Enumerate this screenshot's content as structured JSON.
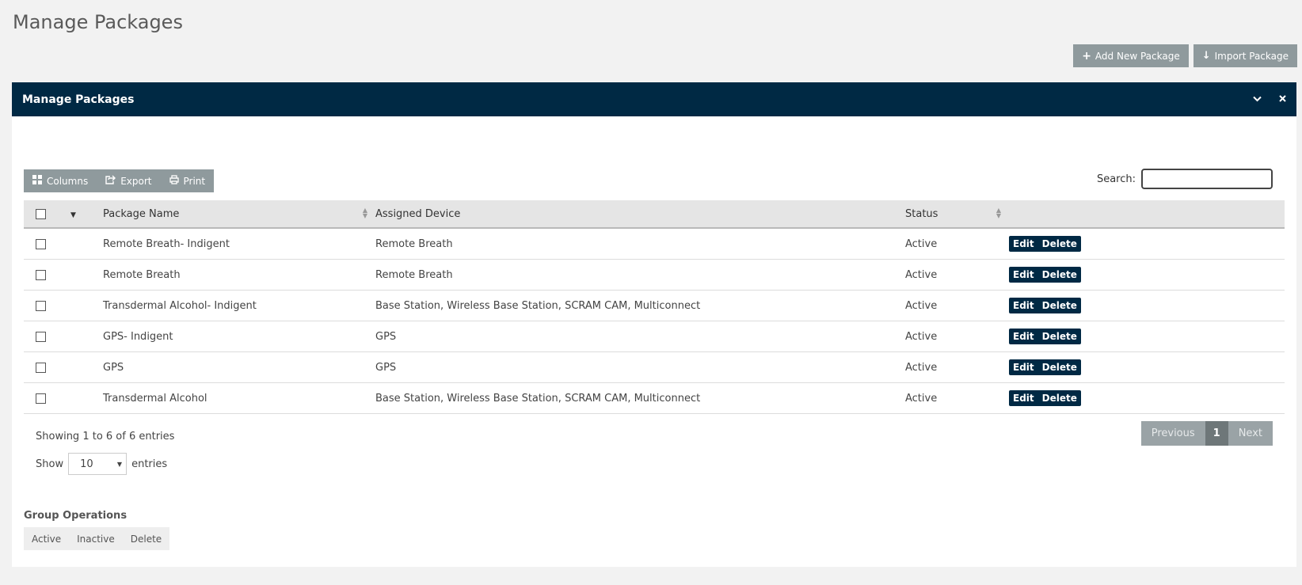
{
  "page": {
    "title": "Manage Packages"
  },
  "top_actions": {
    "add_label": "Add New Package",
    "import_label": "Import Package"
  },
  "panel": {
    "title": "Manage Packages"
  },
  "toolbar": {
    "columns": "Columns",
    "export": "Export",
    "print": "Print"
  },
  "search": {
    "label": "Search:",
    "value": "",
    "placeholder": ""
  },
  "table": {
    "headers": {
      "name": "Package Name",
      "device": "Assigned Device",
      "status": "Status"
    },
    "rows": [
      {
        "name": "Remote Breath- Indigent",
        "device": "Remote Breath",
        "status": "Active",
        "edit": "Edit",
        "delete": "Delete"
      },
      {
        "name": "Remote Breath",
        "device": "Remote Breath",
        "status": "Active",
        "edit": "Edit",
        "delete": "Delete"
      },
      {
        "name": "Transdermal Alcohol- Indigent",
        "device": "Base Station, Wireless Base Station, SCRAM CAM, Multiconnect",
        "status": "Active",
        "edit": "Edit",
        "delete": "Delete"
      },
      {
        "name": "GPS- Indigent",
        "device": "GPS",
        "status": "Active",
        "edit": "Edit",
        "delete": "Delete"
      },
      {
        "name": "GPS",
        "device": "GPS",
        "status": "Active",
        "edit": "Edit",
        "delete": "Delete"
      },
      {
        "name": "Transdermal Alcohol",
        "device": "Base Station, Wireless Base Station, SCRAM CAM, Multiconnect",
        "status": "Active",
        "edit": "Edit",
        "delete": "Delete"
      }
    ]
  },
  "info": {
    "text": "Showing 1 to 6 of 6 entries"
  },
  "length": {
    "show": "Show",
    "value": "10",
    "entries": "entries"
  },
  "pagination": {
    "previous": "Previous",
    "current": "1",
    "next": "Next"
  },
  "group_ops": {
    "label": "Group Operations",
    "active": "Active",
    "inactive": "Inactive",
    "delete": "Delete"
  },
  "colors": {
    "header_bg": "#002944",
    "button_gray": "#8f9a9d",
    "page_bg": "#f2f2f2"
  },
  "icons": [
    "plus-icon",
    "download-arrow-icon",
    "chevron-down-icon",
    "close-icon",
    "columns-grid-icon",
    "export-icon",
    "print-icon",
    "sort-icon",
    "caret-down-icon",
    "select-arrow-icon"
  ]
}
